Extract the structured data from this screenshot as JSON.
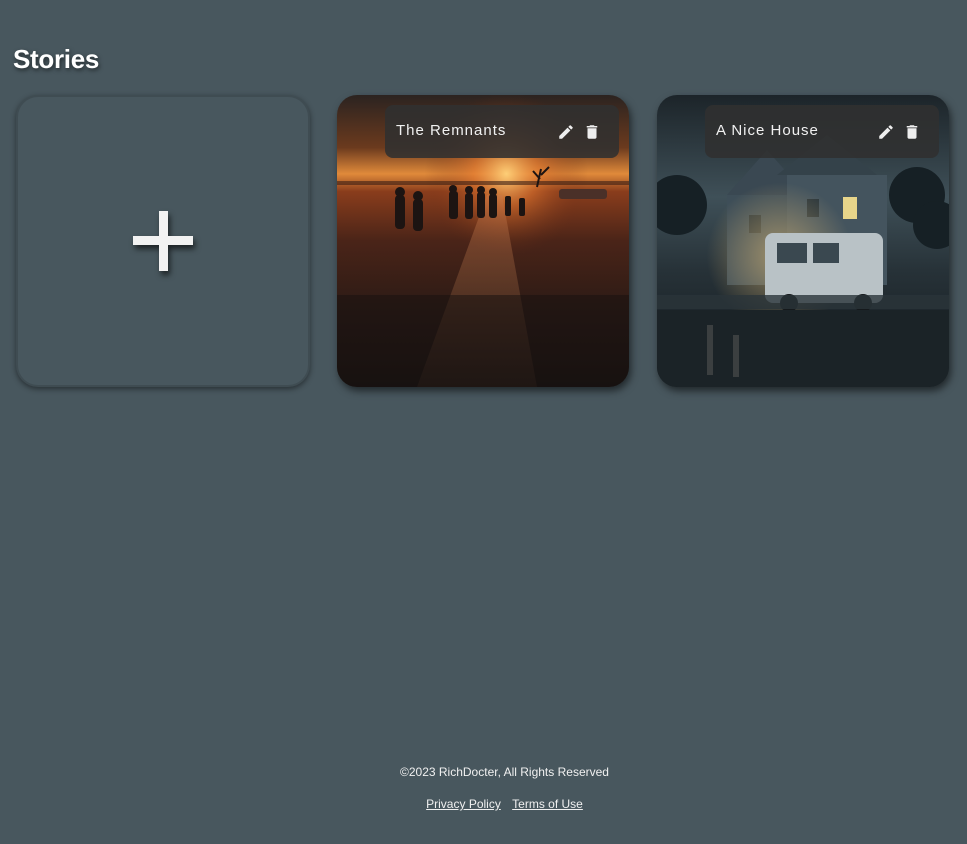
{
  "page": {
    "title": "Stories",
    "background_color": "#48575e"
  },
  "add_story": {
    "icon": "plus-icon"
  },
  "stories": [
    {
      "title": "The Remnants",
      "image": "figures-walking-toward-sunset-wasteland",
      "actions": [
        "edit-icon",
        "trash-icon"
      ]
    },
    {
      "title": "A Nice House",
      "image": "house-with-van-at-night",
      "actions": [
        "edit-icon",
        "trash-icon"
      ]
    }
  ],
  "footer": {
    "copyright": "©2023 RichDocter, All Rights Reserved",
    "privacy_link": "Privacy Policy",
    "terms_link": "Terms of Use"
  }
}
